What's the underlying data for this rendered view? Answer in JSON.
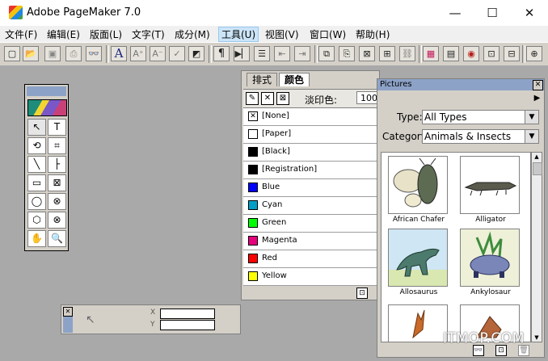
{
  "window": {
    "title": "Adobe PageMaker 7.0",
    "minimize": "—",
    "maximize": "☐",
    "close": "✕"
  },
  "menu": [
    "文件(F)",
    "编辑(E)",
    "版面(L)",
    "文字(T)",
    "成分(M)",
    "工具(U)",
    "视图(V)",
    "窗口(W)",
    "帮助(H)"
  ],
  "toolbar_icons": [
    "new-icon",
    "open-icon",
    "save-icon",
    "print-icon",
    "find-icon",
    "font-icon",
    "font-larger-icon",
    "font-smaller-icon",
    "spell-icon",
    "style-icon",
    "paragraph-icon",
    "thread-text-icon",
    "list-icon",
    "indent-left-icon",
    "indent-right-icon",
    "copy-icon",
    "paste-icon",
    "frame-icon",
    "place-icon",
    "link-icon",
    "color-icon",
    "image-icon",
    "globe-icon",
    "pdf-icon",
    "export-icon",
    "zoom-in-icon"
  ],
  "toolbox_tools": [
    {
      "icon": "pointer-icon",
      "glyph": "↖"
    },
    {
      "icon": "text-tool-icon",
      "glyph": "T"
    },
    {
      "icon": "rotate-icon",
      "glyph": "⟲"
    },
    {
      "icon": "crop-icon",
      "glyph": "⌗"
    },
    {
      "icon": "line-icon",
      "glyph": "╲"
    },
    {
      "icon": "constrained-line-icon",
      "glyph": "├"
    },
    {
      "icon": "rectangle-icon",
      "glyph": "▭"
    },
    {
      "icon": "rectangle-frame-icon",
      "glyph": "⊠"
    },
    {
      "icon": "ellipse-icon",
      "glyph": "◯"
    },
    {
      "icon": "ellipse-frame-icon",
      "glyph": "⊗"
    },
    {
      "icon": "polygon-icon",
      "glyph": "⬡"
    },
    {
      "icon": "polygon-frame-icon",
      "glyph": "⊗"
    },
    {
      "icon": "hand-icon",
      "glyph": "✋"
    },
    {
      "icon": "zoom-icon",
      "glyph": "🔍"
    }
  ],
  "colors_panel": {
    "tabs": [
      "排式",
      "颜色"
    ],
    "tint_label": "淡印色:",
    "tint_value": "100",
    "colors": [
      {
        "name": "[None]",
        "color": "#ffffff"
      },
      {
        "name": "[Paper]",
        "color": "#ffffff"
      },
      {
        "name": "[Black]",
        "color": "#000000"
      },
      {
        "name": "[Registration]",
        "color": "#000000"
      },
      {
        "name": "Blue",
        "color": "#0000ff"
      },
      {
        "name": "Cyan",
        "color": "#00a0c6"
      },
      {
        "name": "Green",
        "color": "#00ff00"
      },
      {
        "name": "Magenta",
        "color": "#e6007e"
      },
      {
        "name": "Red",
        "color": "#ff0000"
      },
      {
        "name": "Yellow",
        "color": "#ffff00"
      }
    ]
  },
  "pictures_panel": {
    "title": "Pictures",
    "type_label": "Type:",
    "type_value": "All Types",
    "category_label": "Category:",
    "category_value": "Animals & Insects",
    "items": [
      "African Chafer",
      "Alligator",
      "Allosaurus",
      "Ankylosaur"
    ]
  },
  "control_palette": {
    "x_label": "X",
    "y_label": "Y"
  },
  "watermark": "ITMOP.COM"
}
